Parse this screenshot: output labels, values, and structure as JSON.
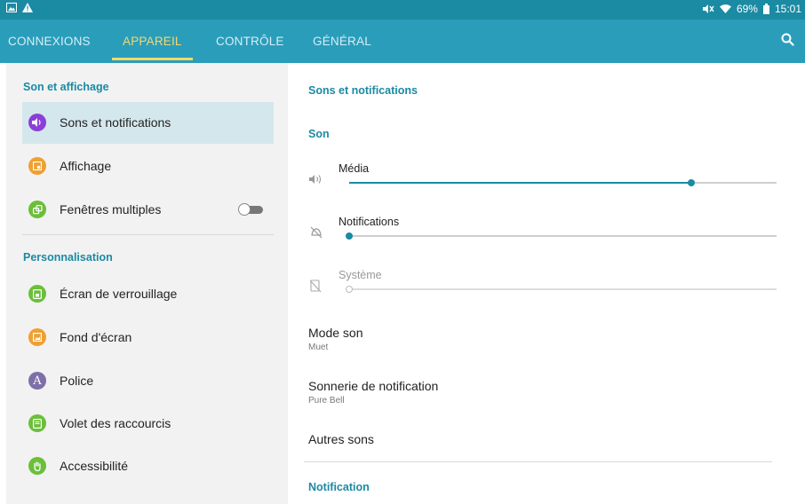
{
  "status_bar": {
    "battery": "69%",
    "time": "15:01"
  },
  "tabs": [
    {
      "label": "CONNEXIONS"
    },
    {
      "label": "APPAREIL"
    },
    {
      "label": "CONTRÔLE"
    },
    {
      "label": "GÉNÉRAL"
    }
  ],
  "colors": {
    "accent": "#1b8aa3",
    "tabbar": "#2a9dbb",
    "active_tab": "#f5d96a"
  },
  "sidebar": {
    "section1": "Son et affichage",
    "section2": "Personnalisation",
    "items": [
      {
        "label": "Sons et notifications",
        "icon": "speaker-icon",
        "color": "#8b3fd6"
      },
      {
        "label": "Affichage",
        "icon": "display-icon",
        "color": "#f0a032"
      },
      {
        "label": "Fenêtres multiples",
        "icon": "multi-window-icon",
        "color": "#6bbf3a"
      },
      {
        "label": "Écran de verrouillage",
        "icon": "lock-screen-icon",
        "color": "#6bbf3a"
      },
      {
        "label": "Fond d'écran",
        "icon": "wallpaper-icon",
        "color": "#f0a032"
      },
      {
        "label": "Police",
        "icon": "font-icon",
        "color": "#7e6fa8",
        "glyph": "A"
      },
      {
        "label": "Volet des raccourcis",
        "icon": "shortcuts-icon",
        "color": "#6bbf3a"
      },
      {
        "label": "Accessibilité",
        "icon": "hand-icon",
        "color": "#6bbf3a"
      }
    ],
    "multi_window_toggle": false
  },
  "main": {
    "title": "Sons et notifications",
    "son_header": "Son",
    "volumes": [
      {
        "label": "Média",
        "level": 0.8,
        "enabled": true
      },
      {
        "label": "Notifications",
        "level": 0.0,
        "enabled": true
      },
      {
        "label": "Système",
        "level": 0.0,
        "enabled": false
      }
    ],
    "mode_son": {
      "title": "Mode son",
      "value": "Muet"
    },
    "sonnerie": {
      "title": "Sonnerie de notification",
      "value": "Pure Bell"
    },
    "autres": {
      "title": "Autres sons"
    },
    "notification_header": "Notification"
  }
}
